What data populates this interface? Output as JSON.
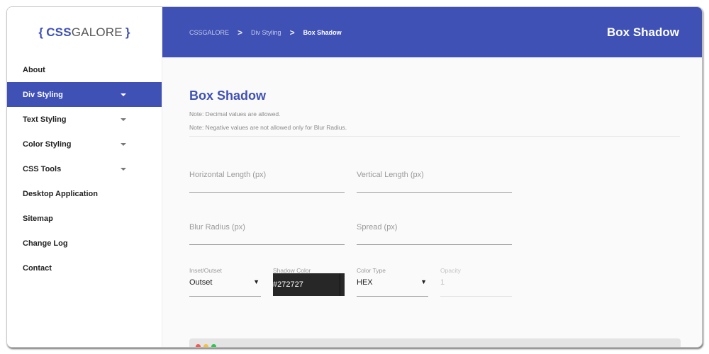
{
  "logo": {
    "open_brace": "{",
    "css": "CSS",
    "galore": "GALORE",
    "close_brace": "}"
  },
  "sidebar": {
    "items": [
      {
        "label": "About",
        "has_submenu": false,
        "active": false
      },
      {
        "label": "Div Styling",
        "has_submenu": true,
        "active": true
      },
      {
        "label": "Text Styling",
        "has_submenu": true,
        "active": false
      },
      {
        "label": "Color Styling",
        "has_submenu": true,
        "active": false
      },
      {
        "label": "CSS Tools",
        "has_submenu": true,
        "active": false
      },
      {
        "label": "Desktop Application",
        "has_submenu": false,
        "active": false
      },
      {
        "label": "Sitemap",
        "has_submenu": false,
        "active": false
      },
      {
        "label": "Change Log",
        "has_submenu": false,
        "active": false
      },
      {
        "label": "Contact",
        "has_submenu": false,
        "active": false
      }
    ]
  },
  "header": {
    "breadcrumb": [
      "CSSGALORE",
      "Div Styling",
      "Box Shadow"
    ],
    "separator": ">",
    "title": "Box Shadow"
  },
  "main": {
    "title": "Box Shadow",
    "notes": [
      "Note: Decimal values are allowed.",
      "Note: Negative values are not allowed only for Blur Radius."
    ],
    "fields": {
      "horizontal": {
        "placeholder": "Horizontal Length (px)",
        "value": ""
      },
      "vertical": {
        "placeholder": "Vertical Length (px)",
        "value": ""
      },
      "blur": {
        "placeholder": "Blur Radius (px)",
        "value": ""
      },
      "spread": {
        "placeholder": "Spread (px)",
        "value": ""
      }
    },
    "inset_outset": {
      "label": "Inset/Outset",
      "value": "Outset",
      "arrow": "▼"
    },
    "shadow_color": {
      "label": "Shadow Color",
      "value": "#272727"
    },
    "color_type": {
      "label": "Color Type",
      "value": "HEX",
      "arrow": "▼"
    },
    "opacity": {
      "label": "Opacity",
      "value": "1"
    }
  },
  "colors": {
    "accent": "#3f51b5",
    "shadow_color_swatch": "#272727",
    "dot_red": "#f25b4f",
    "dot_yellow": "#f9be3b",
    "dot_green": "#2bc84a"
  }
}
